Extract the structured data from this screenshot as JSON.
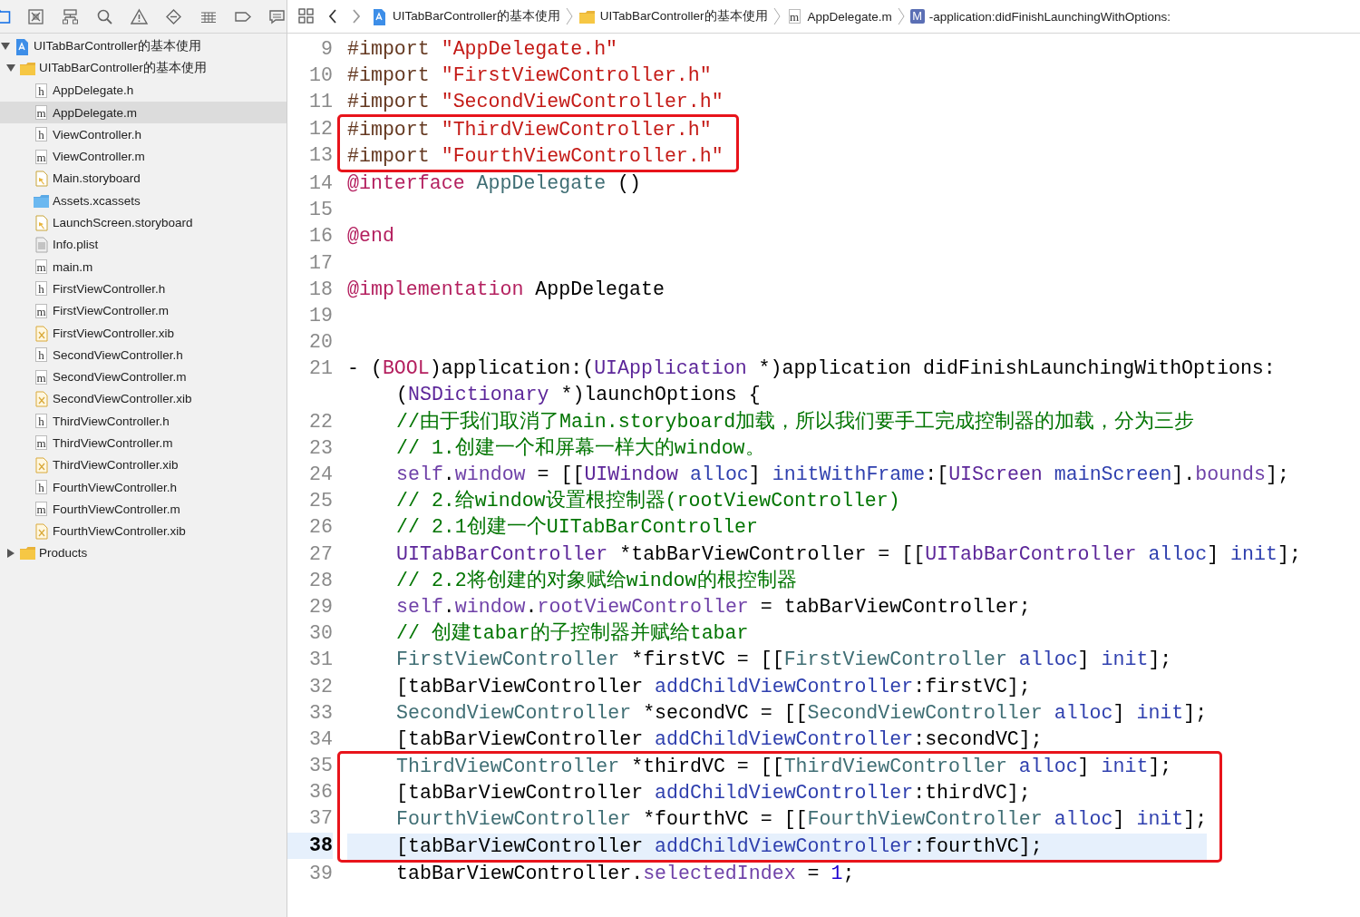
{
  "navigator": {
    "tabs": [
      {
        "kind": "folder",
        "selected": true
      },
      {
        "kind": "source-control",
        "selected": false
      },
      {
        "kind": "hierarchy",
        "selected": false
      },
      {
        "kind": "search",
        "selected": false
      },
      {
        "kind": "warning",
        "selected": false
      },
      {
        "kind": "test",
        "selected": false
      },
      {
        "kind": "debug",
        "selected": false
      },
      {
        "kind": "breakpoint",
        "selected": false
      },
      {
        "kind": "report",
        "selected": false
      }
    ],
    "tree": [
      {
        "name": "UITabBarController的基本使用",
        "kind": "project",
        "selected": false,
        "expanded": true,
        "children": [
          {
            "name": "UITabBarController的基本使用",
            "kind": "group",
            "selected": false,
            "expanded": true,
            "children": [
              {
                "name": "AppDelegate.h",
                "kind": "source",
                "badge": "h",
                "selected": false
              },
              {
                "name": "AppDelegate.m",
                "kind": "source",
                "badge": "m",
                "selected": true
              },
              {
                "name": "ViewController.h",
                "kind": "source",
                "badge": "h",
                "selected": false
              },
              {
                "name": "ViewController.m",
                "kind": "source",
                "badge": "m",
                "selected": false
              },
              {
                "name": "Main.storyboard",
                "kind": "storyboard",
                "selected": false
              },
              {
                "name": "Assets.xcassets",
                "kind": "assets",
                "selected": false
              },
              {
                "name": "LaunchScreen.storyboard",
                "kind": "storyboard",
                "selected": false
              },
              {
                "name": "Info.plist",
                "kind": "plist",
                "selected": false
              },
              {
                "name": "main.m",
                "kind": "source",
                "badge": "m",
                "selected": false
              },
              {
                "name": "FirstViewController.h",
                "kind": "source",
                "badge": "h",
                "selected": false
              },
              {
                "name": "FirstViewController.m",
                "kind": "source",
                "badge": "m",
                "selected": false
              },
              {
                "name": "FirstViewController.xib",
                "kind": "xib",
                "selected": false
              },
              {
                "name": "SecondViewController.h",
                "kind": "source",
                "badge": "h",
                "selected": false
              },
              {
                "name": "SecondViewController.m",
                "kind": "source",
                "badge": "m",
                "selected": false
              },
              {
                "name": "SecondViewController.xib",
                "kind": "xib",
                "selected": false
              },
              {
                "name": "ThirdViewController.h",
                "kind": "source",
                "badge": "h",
                "selected": false
              },
              {
                "name": "ThirdViewController.m",
                "kind": "source",
                "badge": "m",
                "selected": false
              },
              {
                "name": "ThirdViewController.xib",
                "kind": "xib",
                "selected": false
              },
              {
                "name": "FourthViewController.h",
                "kind": "source",
                "badge": "h",
                "selected": false
              },
              {
                "name": "FourthViewController.m",
                "kind": "source",
                "badge": "m",
                "selected": false
              },
              {
                "name": "FourthViewController.xib",
                "kind": "xib",
                "selected": false
              }
            ]
          },
          {
            "name": "Products",
            "kind": "group",
            "selected": false,
            "expanded": false
          }
        ]
      }
    ]
  },
  "jump_bar": {
    "breadcrumbs": [
      {
        "kind": "project",
        "label": "UITabBarController的基本使用"
      },
      {
        "kind": "group",
        "label": "UITabBarController的基本使用"
      },
      {
        "kind": "source",
        "badge": "m",
        "label": "AppDelegate.m"
      },
      {
        "kind": "method",
        "badge": "M",
        "label": "-application:didFinishLaunchingWithOptions:"
      }
    ]
  },
  "editor": {
    "blocks": [
      {
        "kind": "plain",
        "lines": [
          {
            "number": "9",
            "current": false,
            "nested": false,
            "tokens": [
              {
                "kind": "directive",
                "text": "#import "
              },
              {
                "kind": "string",
                "text": "\"AppDelegate.h\""
              }
            ]
          },
          {
            "number": "10",
            "current": false,
            "nested": false,
            "tokens": [
              {
                "kind": "directive",
                "text": "#import "
              },
              {
                "kind": "string",
                "text": "\"FirstViewController.h\""
              }
            ]
          },
          {
            "number": "11",
            "current": false,
            "nested": false,
            "tokens": [
              {
                "kind": "directive",
                "text": "#import "
              },
              {
                "kind": "string",
                "text": "\"SecondViewController.h\""
              }
            ]
          }
        ]
      },
      {
        "kind": "highlighted",
        "lines": [
          {
            "number": "12",
            "current": false,
            "nested": false,
            "tokens": [
              {
                "kind": "directive",
                "text": "#import "
              },
              {
                "kind": "string",
                "text": "\"ThirdViewController.h\""
              }
            ]
          },
          {
            "number": "13",
            "current": false,
            "nested": false,
            "tokens": [
              {
                "kind": "directive",
                "text": "#import "
              },
              {
                "kind": "string",
                "text": "\"FourthViewController.h\""
              }
            ]
          }
        ]
      },
      {
        "kind": "plain",
        "lines": [
          {
            "number": "14",
            "current": false,
            "nested": false,
            "tokens": [
              {
                "kind": "keyword",
                "text": "@interface "
              },
              {
                "kind": "projclass",
                "text": "AppDelegate"
              },
              {
                "kind": "plain",
                "text": " ()"
              }
            ]
          },
          {
            "number": "15",
            "current": false
          },
          {
            "number": "16",
            "current": false,
            "nested": false,
            "tokens": [
              {
                "kind": "keyword",
                "text": "@end"
              }
            ]
          },
          {
            "number": "17",
            "current": false
          },
          {
            "number": "18",
            "current": false,
            "nested": false,
            "tokens": [
              {
                "kind": "keyword",
                "text": "@implementation"
              },
              {
                "kind": "plain",
                "text": " AppDelegate"
              }
            ]
          },
          {
            "number": "19",
            "current": false
          },
          {
            "number": "20",
            "current": false
          },
          {
            "number": "21",
            "current": false,
            "nested": false,
            "tokens": [
              {
                "kind": "plain",
                "text": "- ("
              },
              {
                "kind": "keyword",
                "text": "BOOL"
              },
              {
                "kind": "plain",
                "text": ")application:("
              },
              {
                "kind": "sysclass",
                "text": "UIApplication"
              },
              {
                "kind": "plain",
                "text": " *)application didFinishLaunchingWithOptions:"
              }
            ],
            "wrap": [
              {
                "kind": "plain",
                "text": "("
              },
              {
                "kind": "sysclass",
                "text": "NSDictionary"
              },
              {
                "kind": "plain",
                "text": " *)launchOptions {"
              }
            ]
          },
          {
            "number": "22",
            "current": false,
            "nested": true,
            "tokens": [
              {
                "kind": "comment",
                "text": "//由于我们取消了Main.storyboard加载，所以我们要手工完成控制器的加载，分为三步"
              }
            ]
          },
          {
            "number": "23",
            "current": false,
            "nested": true,
            "tokens": [
              {
                "kind": "comment",
                "text": "// 1.创建一个和屏幕一样大的window。"
              }
            ]
          },
          {
            "number": "24",
            "current": false,
            "nested": true,
            "tokens": [
              {
                "kind": "property",
                "text": "self"
              },
              {
                "kind": "plain",
                "text": "."
              },
              {
                "kind": "property",
                "text": "window"
              },
              {
                "kind": "plain",
                "text": " = [["
              },
              {
                "kind": "sysclass",
                "text": "UIWindow "
              },
              {
                "kind": "method",
                "text": "alloc"
              },
              {
                "kind": "plain",
                "text": "] "
              },
              {
                "kind": "method",
                "text": "initWithFrame"
              },
              {
                "kind": "plain",
                "text": ":["
              },
              {
                "kind": "sysclass",
                "text": "UIScreen "
              },
              {
                "kind": "method",
                "text": "mainScreen"
              },
              {
                "kind": "plain",
                "text": "]."
              },
              {
                "kind": "property",
                "text": "bounds"
              },
              {
                "kind": "plain",
                "text": "];"
              }
            ]
          },
          {
            "number": "25",
            "current": false,
            "nested": true,
            "tokens": [
              {
                "kind": "comment",
                "text": "// 2.给window设置根控制器(rootViewController)"
              }
            ]
          },
          {
            "number": "26",
            "current": false,
            "nested": true,
            "tokens": [
              {
                "kind": "comment",
                "text": "// 2.1创建一个UITabBarController"
              }
            ]
          },
          {
            "number": "27",
            "current": false,
            "nested": true,
            "tokens": [
              {
                "kind": "sysclass",
                "text": "UITabBarController"
              },
              {
                "kind": "plain",
                "text": " *tabBarViewController = [["
              },
              {
                "kind": "sysclass",
                "text": "UITabBarController "
              },
              {
                "kind": "method",
                "text": "alloc"
              },
              {
                "kind": "plain",
                "text": "] "
              },
              {
                "kind": "method",
                "text": "init"
              },
              {
                "kind": "plain",
                "text": "];"
              }
            ]
          },
          {
            "number": "28",
            "current": false,
            "nested": true,
            "tokens": [
              {
                "kind": "comment",
                "text": "// 2.2将创建的对象赋给window的根控制器"
              }
            ]
          },
          {
            "number": "29",
            "current": false,
            "nested": true,
            "tokens": [
              {
                "kind": "property",
                "text": "self"
              },
              {
                "kind": "plain",
                "text": "."
              },
              {
                "kind": "property",
                "text": "window"
              },
              {
                "kind": "plain",
                "text": "."
              },
              {
                "kind": "property",
                "text": "rootViewController"
              },
              {
                "kind": "plain",
                "text": " = tabBarViewController;"
              }
            ]
          },
          {
            "number": "30",
            "current": false,
            "nested": true,
            "tokens": [
              {
                "kind": "comment",
                "text": "// 创建tabar的子控制器并赋给tabar"
              }
            ]
          },
          {
            "number": "31",
            "current": false,
            "nested": true,
            "tokens": [
              {
                "kind": "projclass",
                "text": "FirstViewController"
              },
              {
                "kind": "plain",
                "text": " *firstVC = [["
              },
              {
                "kind": "projclass",
                "text": "FirstViewController "
              },
              {
                "kind": "method",
                "text": "alloc"
              },
              {
                "kind": "plain",
                "text": "] "
              },
              {
                "kind": "method",
                "text": "init"
              },
              {
                "kind": "plain",
                "text": "];"
              }
            ]
          },
          {
            "number": "32",
            "current": false,
            "nested": true,
            "tokens": [
              {
                "kind": "plain",
                "text": "[tabBarViewController "
              },
              {
                "kind": "method",
                "text": "addChildViewController"
              },
              {
                "kind": "plain",
                "text": ":firstVC];"
              }
            ]
          },
          {
            "number": "33",
            "current": false,
            "nested": true,
            "tokens": [
              {
                "kind": "projclass",
                "text": "SecondViewController"
              },
              {
                "kind": "plain",
                "text": " *secondVC = [["
              },
              {
                "kind": "projclass",
                "text": "SecondViewController "
              },
              {
                "kind": "method",
                "text": "alloc"
              },
              {
                "kind": "plain",
                "text": "] "
              },
              {
                "kind": "method",
                "text": "init"
              },
              {
                "kind": "plain",
                "text": "];"
              }
            ]
          },
          {
            "number": "34",
            "current": false,
            "nested": true,
            "tokens": [
              {
                "kind": "plain",
                "text": "[tabBarViewController "
              },
              {
                "kind": "method",
                "text": "addChildViewController"
              },
              {
                "kind": "plain",
                "text": ":secondVC];"
              }
            ]
          }
        ]
      },
      {
        "kind": "highlighted",
        "lines": [
          {
            "number": "35",
            "current": false,
            "nested": true,
            "tokens": [
              {
                "kind": "projclass",
                "text": "ThirdViewController"
              },
              {
                "kind": "plain",
                "text": " *thirdVC = [["
              },
              {
                "kind": "projclass",
                "text": "ThirdViewController "
              },
              {
                "kind": "method",
                "text": "alloc"
              },
              {
                "kind": "plain",
                "text": "] "
              },
              {
                "kind": "method",
                "text": "init"
              },
              {
                "kind": "plain",
                "text": "];"
              }
            ]
          },
          {
            "number": "36",
            "current": false,
            "nested": true,
            "tokens": [
              {
                "kind": "plain",
                "text": "[tabBarViewController "
              },
              {
                "kind": "method",
                "text": "addChildViewController"
              },
              {
                "kind": "plain",
                "text": ":thirdVC];"
              }
            ]
          },
          {
            "number": "37",
            "current": false,
            "nested": true,
            "tokens": [
              {
                "kind": "projclass",
                "text": "FourthViewController"
              },
              {
                "kind": "plain",
                "text": " *fourthVC = [["
              },
              {
                "kind": "projclass",
                "text": "FourthViewController "
              },
              {
                "kind": "method",
                "text": "alloc"
              },
              {
                "kind": "plain",
                "text": "] "
              },
              {
                "kind": "method",
                "text": "init"
              },
              {
                "kind": "plain",
                "text": "];"
              }
            ]
          },
          {
            "number": "38",
            "current": true,
            "nested": true,
            "tokens": [
              {
                "kind": "plain",
                "text": "[tabBarViewController "
              },
              {
                "kind": "method",
                "text": "addChildViewController"
              },
              {
                "kind": "plain",
                "text": ":fourthVC];"
              }
            ]
          }
        ]
      },
      {
        "kind": "plain",
        "lines": [
          {
            "number": "39",
            "current": false,
            "nested": true,
            "tokens": [
              {
                "kind": "plain",
                "text": "tabBarViewController."
              },
              {
                "kind": "property",
                "text": "selectedIndex"
              },
              {
                "kind": "plain",
                "text": " = "
              },
              {
                "kind": "number",
                "text": "1"
              },
              {
                "kind": "plain",
                "text": ";"
              }
            ]
          }
        ]
      }
    ]
  }
}
